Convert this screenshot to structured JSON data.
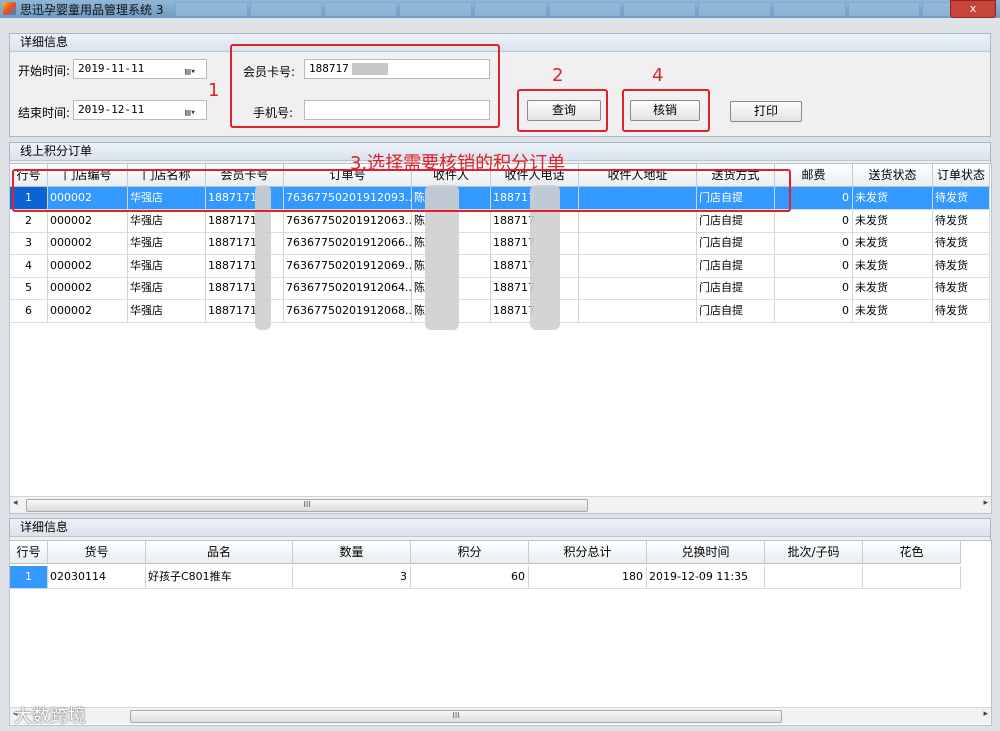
{
  "window": {
    "title": "思迅孕婴童用品管理系统 3",
    "close_label": "x"
  },
  "filter": {
    "section_title": "详细信息",
    "start_label": "开始时间:",
    "start_value": "2019-11-11",
    "end_label": "结束时间:",
    "end_value": "2019-12-11",
    "card_label": "会员卡号:",
    "card_value": "188717",
    "phone_label": "手机号:",
    "phone_value": "",
    "query_label": "查询",
    "verify_label": "核销",
    "print_label": "打印"
  },
  "annotations": {
    "step1": "1",
    "step2": "2",
    "step3": "3.选择需要核销的积分订单",
    "step4": "4"
  },
  "orders": {
    "section_title": "线上积分订单",
    "columns": [
      "行号",
      "门店编号",
      "门店名称",
      "会员卡号",
      "订单号",
      "收件人",
      "收件人电话",
      "收件人地址",
      "送货方式",
      "邮费",
      "送货状态",
      "订单状态"
    ],
    "rows": [
      {
        "idx": "1",
        "store_no": "000002",
        "store": "华强店",
        "card": "1887171",
        "order": "76367750201912093...",
        "recipient": "陈",
        "phone": "188717",
        "addr": "",
        "ship": "门店自提",
        "fee": "0",
        "ship_status": "未发货",
        "order_status": "待发货"
      },
      {
        "idx": "2",
        "store_no": "000002",
        "store": "华强店",
        "card": "1887171",
        "order": "76367750201912063...",
        "recipient": "陈",
        "phone": "188717",
        "addr": "",
        "ship": "门店自提",
        "fee": "0",
        "ship_status": "未发货",
        "order_status": "待发货"
      },
      {
        "idx": "3",
        "store_no": "000002",
        "store": "华强店",
        "card": "1887171",
        "order": "76367750201912066...",
        "recipient": "陈",
        "phone": "188717",
        "addr": "",
        "ship": "门店自提",
        "fee": "0",
        "ship_status": "未发货",
        "order_status": "待发货"
      },
      {
        "idx": "4",
        "store_no": "000002",
        "store": "华强店",
        "card": "1887171",
        "order": "76367750201912069...",
        "recipient": "陈",
        "phone": "188717",
        "addr": "",
        "ship": "门店自提",
        "fee": "0",
        "ship_status": "未发货",
        "order_status": "待发货"
      },
      {
        "idx": "5",
        "store_no": "000002",
        "store": "华强店",
        "card": "1887171",
        "order": "76367750201912064...",
        "recipient": "陈",
        "phone": "188717",
        "addr": "",
        "ship": "门店自提",
        "fee": "0",
        "ship_status": "未发货",
        "order_status": "待发货"
      },
      {
        "idx": "6",
        "store_no": "000002",
        "store": "华强店",
        "card": "1887171",
        "order": "76367750201912068...",
        "recipient": "陈",
        "phone": "188717",
        "addr": "",
        "ship": "门店自提",
        "fee": "0",
        "ship_status": "未发货",
        "order_status": "待发货"
      }
    ],
    "scroll_grip": "III"
  },
  "details": {
    "section_title": "详细信息",
    "columns": [
      "行号",
      "货号",
      "品名",
      "数量",
      "积分",
      "积分总计",
      "兑换时间",
      "批次/子码",
      "花色"
    ],
    "rows": [
      {
        "idx": "1",
        "sku": "02030114",
        "name": "好孩子C801推车",
        "qty": "3",
        "points": "60",
        "total": "180",
        "time": "2019-12-09 11:35",
        "batch": "",
        "color": ""
      }
    ],
    "scroll_grip": "III"
  },
  "watermark": "大数跨境",
  "colors": {
    "accent": "#e0202a",
    "selection": "#3399ff"
  }
}
